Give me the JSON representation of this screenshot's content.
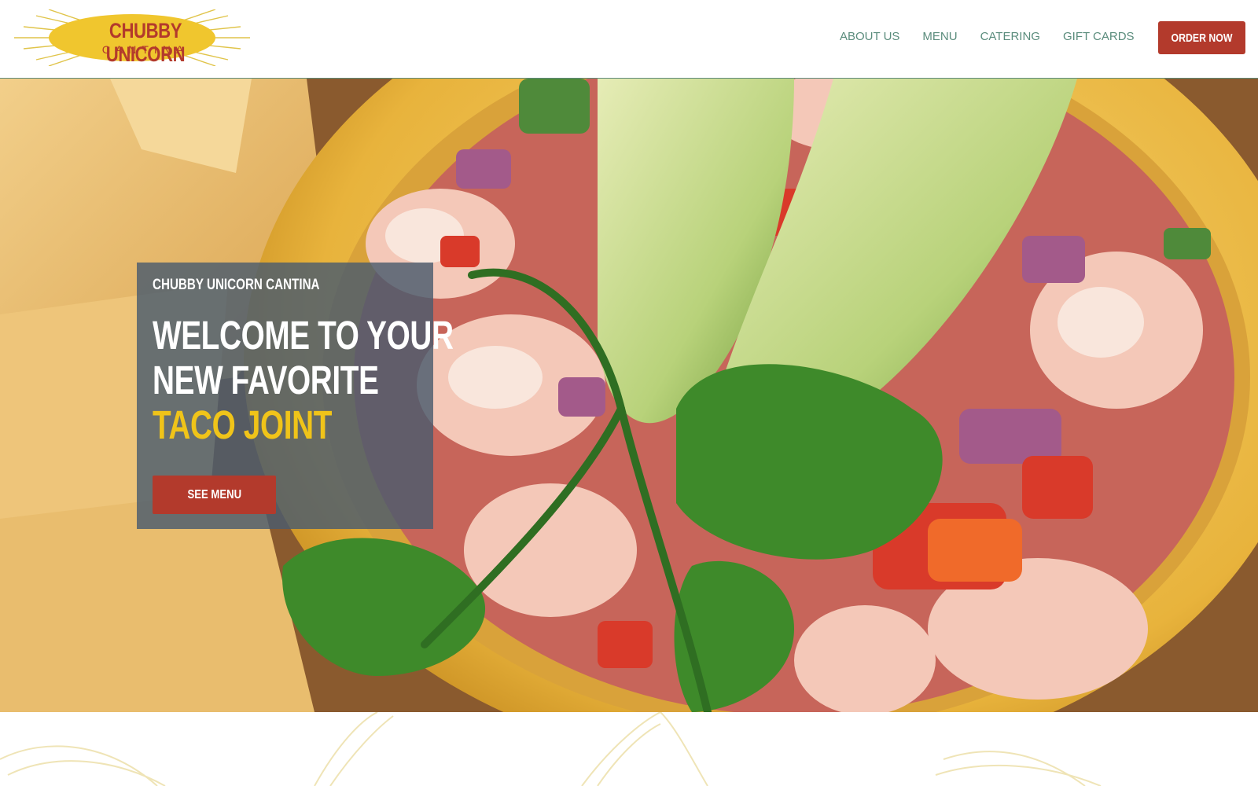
{
  "brand": {
    "name_line1": "CHUBBY UNICORN",
    "name_line2": "CANTINA",
    "colors": {
      "primary_red": "#b33a2c",
      "accent_yellow": "#f0c419",
      "nav_green": "#5a8c7c"
    }
  },
  "nav": {
    "items": [
      {
        "label": "ABOUT US"
      },
      {
        "label": "MENU"
      },
      {
        "label": "CATERING"
      },
      {
        "label": "GIFT CARDS"
      }
    ],
    "order_button": "ORDER NOW"
  },
  "hero": {
    "eyebrow": "CHUBBY UNICORN CANTINA",
    "title_line1": "WELCOME TO YOUR",
    "title_line2": "NEW FAVORITE",
    "title_line3": "TACO JOINT",
    "cta": "SEE MENU",
    "image_icon": "ceviche-bowl-photo"
  }
}
